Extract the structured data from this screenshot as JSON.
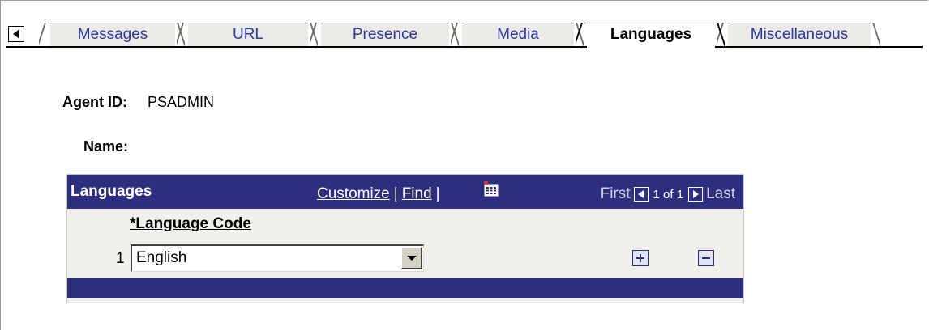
{
  "tabs": [
    {
      "label": "Messages",
      "active": false
    },
    {
      "label": "URL",
      "active": false
    },
    {
      "label": "Presence",
      "active": false
    },
    {
      "label": "Media",
      "active": false
    },
    {
      "label": "Languages",
      "active": true
    },
    {
      "label": "Miscellaneous",
      "active": false
    }
  ],
  "header": {
    "agent_id_label": "Agent ID:",
    "agent_id_value": "PSADMIN",
    "name_label": "Name:",
    "name_value": ""
  },
  "grid": {
    "title": "Languages",
    "customize_link": "Customize",
    "find_link": "Find",
    "separator": "|",
    "first_label": "First",
    "page_count": "1 of 1",
    "last_label": "Last",
    "column_header": "*Language Code",
    "rows": [
      {
        "number": "1",
        "language": "English"
      }
    ]
  },
  "colors": {
    "grid_header": "#2e2e7e",
    "tab_link": "#2d39a0",
    "grid_body": "#f1efeb"
  },
  "icons": [
    "scroll-left-icon",
    "download-grid-icon",
    "previous-icon",
    "next-icon",
    "dropdown-arrow-icon",
    "add-row-icon",
    "delete-row-icon"
  ]
}
